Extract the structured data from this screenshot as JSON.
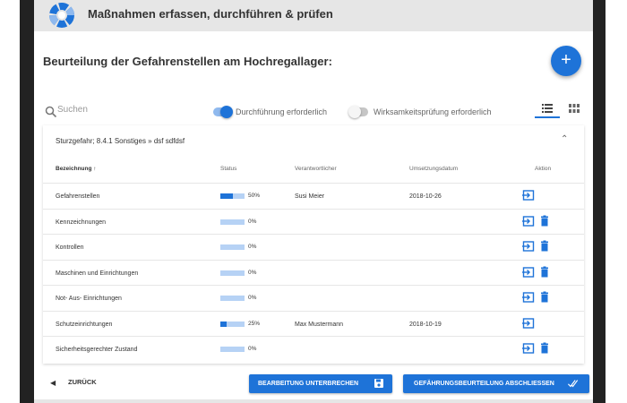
{
  "app": {
    "title": "Maßnahmen erfassen, durchführen & prüfen"
  },
  "page": {
    "title": "Beurteilung der Gefahrenstellen am Hochregallager:",
    "fab_label": "+"
  },
  "toolbar": {
    "search_placeholder": "Suchen",
    "toggles": [
      {
        "label": "Durchführung erforderlich",
        "on": true
      },
      {
        "label": "Wirksamkeitsprüfung erforderlich",
        "on": false
      }
    ],
    "active_view": "list"
  },
  "card": {
    "title": "Sturzgefahr; 8.4.1 Sonstiges » dsf sdfdsf",
    "columns": {
      "bezeichnung": "Bezeichnung",
      "status": "Status",
      "verantwortlicher": "Verantwortlicher",
      "datum": "Umsetzungsdatum",
      "aktion": "Aktion"
    },
    "rows": [
      {
        "name": "Gefahrenstellen",
        "progress": 50,
        "progress_label": "50%",
        "owner": "Susi Meier",
        "date": "2018-10-26",
        "deletable": false
      },
      {
        "name": "Kennzeichnungen",
        "progress": 0,
        "progress_label": "0%",
        "owner": "",
        "date": "",
        "deletable": true
      },
      {
        "name": "Kontrollen",
        "progress": 0,
        "progress_label": "0%",
        "owner": "",
        "date": "",
        "deletable": true
      },
      {
        "name": "Maschinen und Einrichtungen",
        "progress": 0,
        "progress_label": "0%",
        "owner": "",
        "date": "",
        "deletable": true
      },
      {
        "name": "Not- Aus- Einrichtungen",
        "progress": 0,
        "progress_label": "0%",
        "owner": "",
        "date": "",
        "deletable": true
      },
      {
        "name": "Schutzeinrichtungen",
        "progress": 25,
        "progress_label": "25%",
        "owner": "Max Mustermann",
        "date": "2018-10-19",
        "deletable": false
      },
      {
        "name": "Sicherheitsgerechter Zustand",
        "progress": 0,
        "progress_label": "0%",
        "owner": "",
        "date": "",
        "deletable": true
      }
    ]
  },
  "footer": {
    "back_label": "ZURÜCK",
    "pause_label": "BEARBEITUNG UNTERBRECHEN",
    "finish_label": "GEFÄHRUNGSBEURTEILUNG ABSCHLIESSEN"
  },
  "colors": {
    "accent": "#1e73d8",
    "progress_track": "#b6d2f5",
    "header_bg": "#e6e6e6"
  },
  "icons": {
    "logo": "segmented-ring-logo",
    "search": "search-icon",
    "list_view": "list-view-icon",
    "grid_view": "grid-view-icon",
    "collapse": "chevron-up-icon",
    "sort": "arrow-up-icon",
    "open": "open-entry-icon",
    "delete": "trash-icon",
    "back": "caret-left-icon",
    "save": "save-icon",
    "done": "double-check-icon"
  }
}
